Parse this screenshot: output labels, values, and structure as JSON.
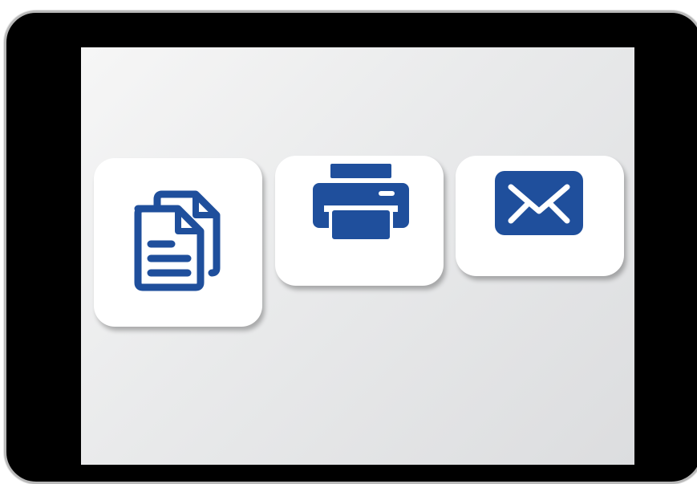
{
  "colors": {
    "accent": "#1f4f9c",
    "tile_background": "#ffffff",
    "screen_background": "#e8e9ea",
    "device_frame": "#000000",
    "device_edge": "#b9b9b9"
  },
  "tiles": [
    {
      "icon": "documents-icon",
      "action": "documents"
    },
    {
      "icon": "printer-icon",
      "action": "print"
    },
    {
      "icon": "mail-icon",
      "action": "mail"
    }
  ]
}
